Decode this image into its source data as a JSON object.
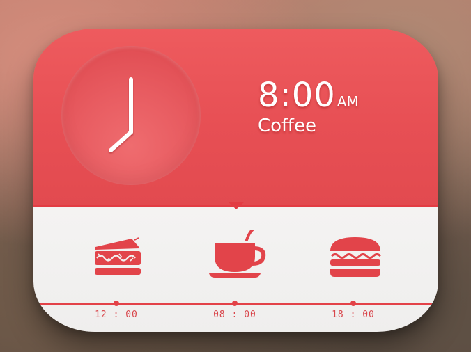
{
  "widget": {
    "time": "8:00",
    "ampm": "AM",
    "event": "Coffee",
    "clock": {
      "hour": 8,
      "minute": 0
    }
  },
  "schedule": [
    {
      "time": "12 : 00",
      "icon": "sandwich-icon"
    },
    {
      "time": "08 : 00",
      "icon": "coffee-cup-icon",
      "active": true
    },
    {
      "time": "18 : 00",
      "icon": "burger-icon"
    }
  ],
  "colors": {
    "accent": "#e74f54",
    "panel_light": "#f1f0ef",
    "icon": "#e2444a",
    "text": "#ffffff"
  }
}
